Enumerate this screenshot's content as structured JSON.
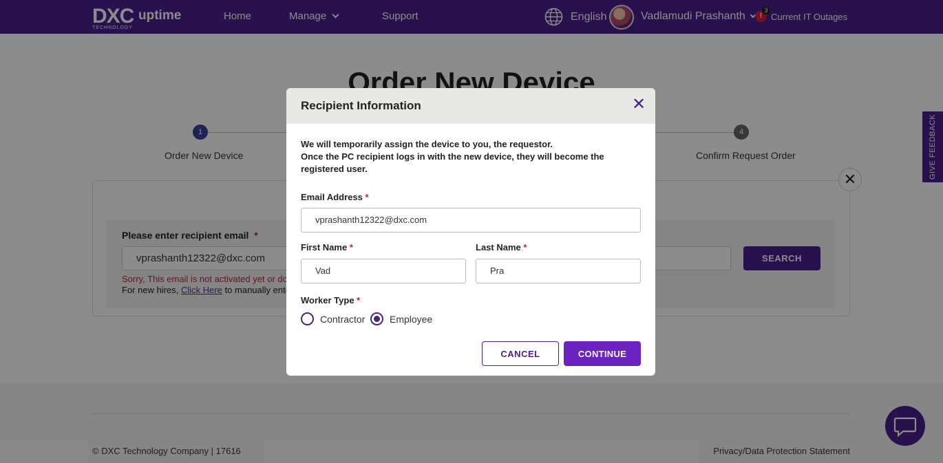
{
  "header": {
    "logo_text": "DXC",
    "logo_sub": "TECHNOLOGY",
    "app_name": "uptime",
    "nav": {
      "home": "Home",
      "manage": "Manage",
      "support": "Support"
    },
    "language": "English",
    "user_name": "Vadlamudi Prashanth",
    "alert_count": "3",
    "alert_symbol": "!",
    "outages_label": "Current IT Outages"
  },
  "page": {
    "title": "Order New Device",
    "steps": [
      {
        "number": "1",
        "label": "Order New Device"
      },
      {
        "number": "4",
        "label": "Confirm Request Order"
      }
    ],
    "recipient_label": "Please enter recipient email",
    "required_mark": "*",
    "recipient_value": "vprashanth12322@dxc.com",
    "search_label": "SEARCH",
    "error_text": "Sorry, This email is not activated yet or doe",
    "hire_prefix": "For new hires, ",
    "hire_link": "Click Here",
    "hire_suffix": " to manually ente",
    "feedback_label": "GIVE FEEDBACK",
    "close_symbol": "✕"
  },
  "footer": {
    "copyright": "© DXC Technology Company | 17616",
    "privacy": "Privacy/Data Protection Statement"
  },
  "modal": {
    "title": "Recipient Information",
    "close_symbol": "✕",
    "intro_line1": "We will temporarily assign the device to you, the requestor.",
    "intro_line2": "Once the PC recipient logs in with the new device, they will become the registered user.",
    "email_label": "Email Address",
    "email_value": "vprashanth12322@dxc.com",
    "first_name_label": "First Name",
    "first_name_value": "Vad",
    "last_name_label": "Last Name",
    "last_name_value": "Pra",
    "worker_type_label": "Worker Type",
    "worker_types": [
      "Contractor",
      "Employee"
    ],
    "selected_worker_type": "Employee",
    "cancel_label": "CANCEL",
    "continue_label": "CONTINUE"
  },
  "colors": {
    "brand": "#4a1f8c",
    "button": "#6a22c0",
    "error": "#c0203a"
  },
  "icons": [
    "globe-icon",
    "chevron-down-icon",
    "alert-icon",
    "close-icon",
    "chat-icon"
  ]
}
